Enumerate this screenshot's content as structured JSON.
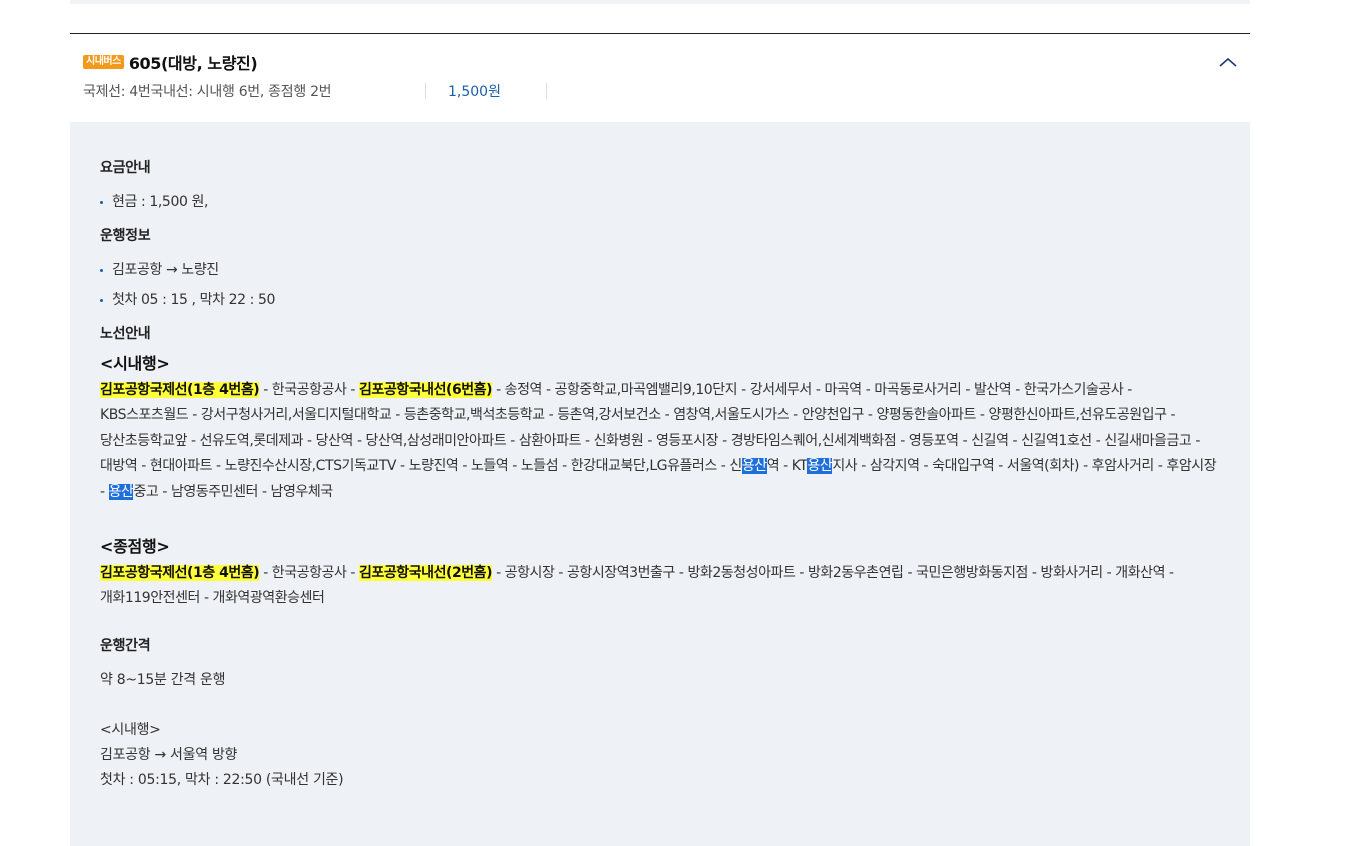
{
  "bus": {
    "badge": "시내버스",
    "title": "605(대방, 노량진)",
    "terminal": "국제선: 4번국내선: 시내행 6번, 종점행 2번",
    "fare": "1,500원"
  },
  "fare_section": {
    "title": "요금안내",
    "items": [
      "현금 : 1,500 원,"
    ]
  },
  "operation_section": {
    "title": "운행정보",
    "items": [
      "김포공항 → 노량진",
      "첫차 05 : 15 , 막차 22 : 50"
    ]
  },
  "route_section": {
    "title": "노선안내",
    "inbound": {
      "label": "<시내행>",
      "segments": [
        {
          "t": "김포공항국제선(1층 4번홈)",
          "s": "hl"
        },
        {
          "t": " - 한국공항공사 - "
        },
        {
          "t": "김포공항국내선(6번홈)",
          "s": "hl"
        },
        {
          "t": " - 송정역 - 공항중학교,마곡엠밸리9,10단지 - 강서세무서 - 마곡역 - 마곡동로사거리 - 발산역 - 한국가스기술공사 - KBS스포츠월드 - 강서구청사거리,서울디지털대학교 - 등촌중학교,백석초등학교 - 등촌역,강서보건소 - 염창역,서울도시가스 - 안양천입구 - 양평동한솔아파트 - 양평한신아파트,선유도공원입구 - 당산초등학교앞 - 선유도역,롯데제과 - 당산역 - 당산역,삼성래미안아파트 - 삼환아파트 - 신화병원 - 영등포시장 - 경방타임스퀘어,신세계백화점 - 영등포역 - 신길역 - 신길역1호선 - 신길새마을금고 - 대방역 - 현대아파트 - 노량진수산시장,CTS기독교TV - 노량진역 - 노들역 - 노들섬 - 한강대교북단,LG유플러스 - 신"
        },
        {
          "t": "용산",
          "s": "sel"
        },
        {
          "t": "역 - KT"
        },
        {
          "t": "용산",
          "s": "sel"
        },
        {
          "t": "지사 - 삼각지역 - 숙대입구역 - 서울역(회차) - 후암사거리 - 후암시장 - "
        },
        {
          "t": "용산",
          "s": "sel"
        },
        {
          "t": "중고 - 남영동주민센터 - 남영우체국"
        }
      ]
    },
    "outbound": {
      "label": "<종점행>",
      "segments": [
        {
          "t": "김포공항국제선(1층 4번홈)",
          "s": "hl"
        },
        {
          "t": " - 한국공항공사 - "
        },
        {
          "t": "김포공항국내선(2번홈)",
          "s": "hl"
        },
        {
          "t": " - 공항시장 - 공항시장역3번출구 - 방화2동청성아파트 - 방화2동우촌연립 - 국민은행방화동지점 - 방화사거리 - 개화산역 - 개화119안전센터 - 개화역광역환승센터"
        }
      ]
    }
  },
  "interval_section": {
    "title": "운행간격",
    "text": "약 8~15분 간격 운행",
    "direction_label": "<시내행>",
    "direction_text": "김포공항 → 서울역 방향",
    "times": "첫차 : 05:15, 막차 : 22:50 (국내선 기준)"
  },
  "icons": {
    "toggle": "chevron-up-icon",
    "bullet": "bullet-dot-icon"
  },
  "colors": {
    "badge": "#f39a1d",
    "fare": "#1a5fa8",
    "panel_bg": "#eef1f5",
    "stop_highlight": "#ffff3a",
    "selection": "#1e6fd9"
  }
}
